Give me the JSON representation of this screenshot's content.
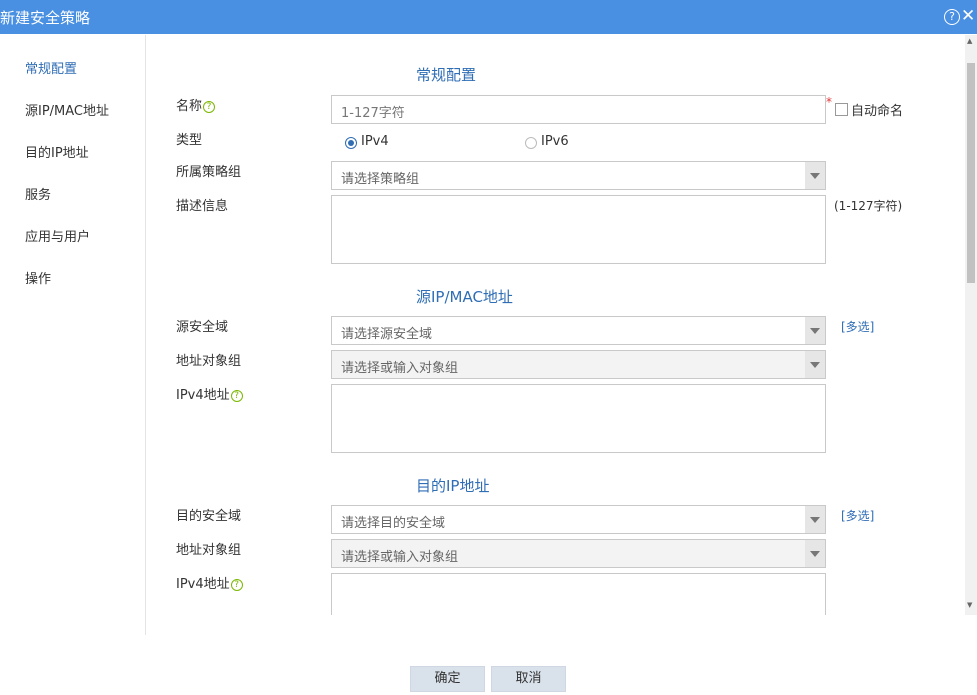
{
  "dialog": {
    "title": "新建安全策略",
    "help_glyph": "?",
    "close_glyph": "✕"
  },
  "sidebar": {
    "items": [
      "常规配置",
      "源IP/MAC地址",
      "目的IP地址",
      "服务",
      "应用与用户",
      "操作"
    ]
  },
  "general": {
    "title": "常规配置",
    "name_label": "名称",
    "name_placeholder": "1-127字符",
    "required_mark": "*",
    "auto_name_label": "自动命名",
    "type_label": "类型",
    "type_options": [
      "IPv4",
      "IPv6"
    ],
    "type_selected": "IPv4",
    "group_label": "所属策略组",
    "group_placeholder": "请选择策略组",
    "desc_label": "描述信息",
    "desc_hint": "(1-127字符)"
  },
  "source": {
    "title": "源IP/MAC地址",
    "zone_label": "源安全域",
    "zone_placeholder": "请选择源安全域",
    "multi_label": "[多选]",
    "objgroup_label": "地址对象组",
    "objgroup_placeholder": "请选择或输入对象组",
    "ipv4_label": "IPv4地址"
  },
  "destination": {
    "title": "目的IP地址",
    "zone_label": "目的安全域",
    "zone_placeholder": "请选择目的安全域",
    "multi_label": "[多选]",
    "objgroup_label": "地址对象组",
    "objgroup_placeholder": "请选择或输入对象组",
    "ipv4_label": "IPv4地址"
  },
  "footer": {
    "ok_label": "确定",
    "cancel_label": "取消"
  },
  "help_icon_glyph": "?",
  "colors": {
    "titlebar": "#4a90e2",
    "accent": "#2f6db5",
    "help_green": "#7ab800",
    "required": "#e0383b"
  }
}
